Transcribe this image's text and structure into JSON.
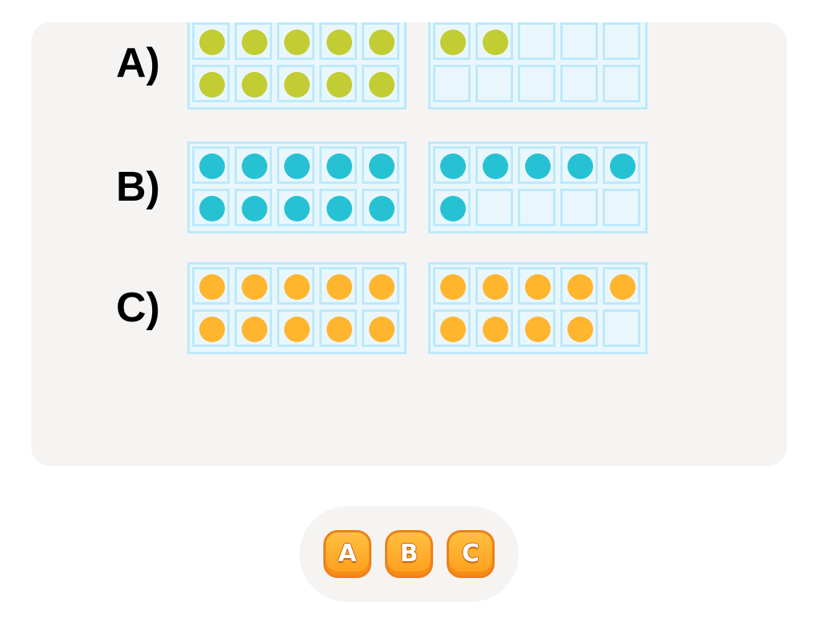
{
  "question": {
    "options": [
      {
        "label": "A)",
        "color": "#c2cc33",
        "frames": [
          [
            true,
            true,
            true,
            true,
            true,
            true,
            true,
            true,
            true,
            true
          ],
          [
            true,
            true,
            false,
            false,
            false,
            false,
            false,
            false,
            false,
            false
          ]
        ]
      },
      {
        "label": "B)",
        "color": "#26c2d3",
        "frames": [
          [
            true,
            true,
            true,
            true,
            true,
            true,
            true,
            true,
            true,
            true
          ],
          [
            true,
            true,
            true,
            true,
            true,
            true,
            false,
            false,
            false,
            false
          ]
        ]
      },
      {
        "label": "C)",
        "color": "#ffb52e",
        "frames": [
          [
            true,
            true,
            true,
            true,
            true,
            true,
            true,
            true,
            true,
            true
          ],
          [
            true,
            true,
            true,
            true,
            true,
            true,
            true,
            true,
            true,
            false
          ]
        ]
      }
    ]
  },
  "answers": {
    "buttons": [
      "A",
      "B",
      "C"
    ]
  },
  "colors": {
    "frame_border": "#bde9fb",
    "frame_fill": "#e9f7fc",
    "button_orange": "#ffa726",
    "button_border": "#ef7f1a"
  }
}
